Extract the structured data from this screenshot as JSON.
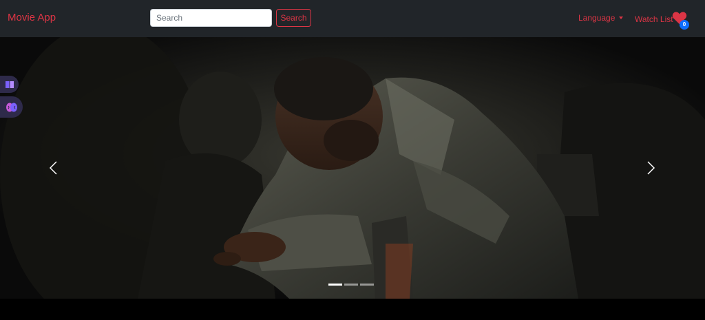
{
  "navbar": {
    "brand": "Movie App",
    "search_placeholder": "Search",
    "search_value": "",
    "search_button": "Search",
    "language_label": "Language",
    "watchlist_label": "Watch List",
    "watchlist_count": "0"
  },
  "carousel": {
    "slide_count": 3,
    "active_index": 0
  },
  "colors": {
    "accent": "#dc3545",
    "navbar_bg": "#212529",
    "badge": "#0d6efd"
  },
  "icons": {
    "prev": "chevron-left-icon",
    "next": "chevron-right-icon",
    "watchlist": "heart-icon",
    "side_tab_1": "book-icon",
    "side_tab_2": "brain-icon"
  }
}
